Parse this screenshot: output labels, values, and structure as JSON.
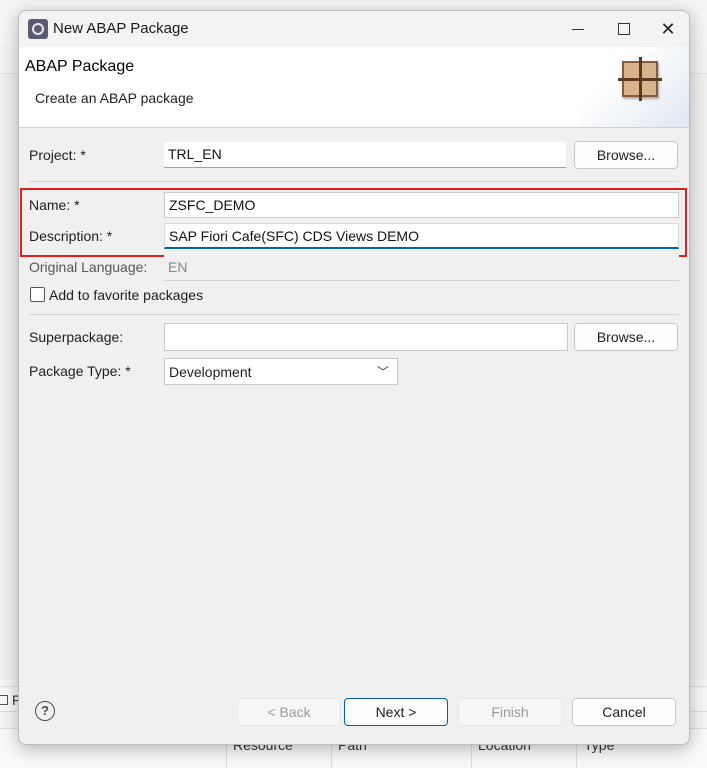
{
  "dialog": {
    "title": "New ABAP Package",
    "header_title": "ABAP Package",
    "header_subtitle": "Create an ABAP package"
  },
  "form": {
    "project_label": "Project: *",
    "project_value": "TRL_EN",
    "browse_label": "Browse...",
    "name_label": "Name: *",
    "name_value": "ZSFC_DEMO",
    "description_label": "Description: *",
    "description_value": "SAP Fiori Cafe(SFC) CDS Views DEMO",
    "language_label": "Original Language:",
    "language_value": "EN",
    "favorite_label": "Add to favorite packages",
    "favorite_checked": false,
    "superpackage_label": "Superpackage:",
    "superpackage_value": "",
    "superpackage_browse_label": "Browse...",
    "package_type_label": "Package Type: *",
    "package_type_value": "Development"
  },
  "footer": {
    "help_symbol": "?",
    "back_label": "< Back",
    "next_label": "Next >",
    "finish_label": "Finish",
    "cancel_label": "Cancel"
  },
  "background": {
    "tab_letter": "F",
    "columns": [
      "Resource",
      "Path",
      "Location",
      "Type"
    ]
  },
  "colors": {
    "highlight_border": "#e0201b",
    "focus_accent": "#005fb8"
  },
  "icons": [
    "eclipse-app-icon",
    "minimize-icon",
    "maximize-icon",
    "close-icon",
    "abap-package-icon",
    "chevron-down-icon",
    "help-icon"
  ]
}
